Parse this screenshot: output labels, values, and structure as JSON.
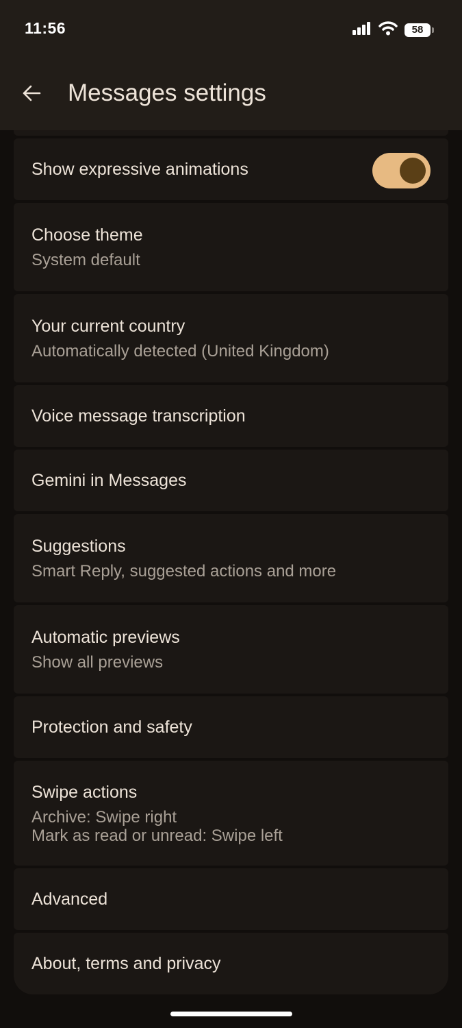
{
  "status_bar": {
    "time": "11:56",
    "battery": "58",
    "icons": [
      "signal-icon",
      "wifi-icon",
      "battery-icon"
    ]
  },
  "app_bar": {
    "title": "Messages settings",
    "back_icon": "arrow-back-icon"
  },
  "settings": {
    "items": [
      {
        "title": "Show expressive animations",
        "toggle_on": true
      },
      {
        "title": "Choose theme",
        "subtitle": "System default"
      },
      {
        "title": "Your current country",
        "subtitle": "Automatically detected (United Kingdom)"
      },
      {
        "title": "Voice message transcription"
      },
      {
        "title": "Gemini in Messages"
      },
      {
        "title": "Suggestions",
        "subtitle": "Smart Reply, suggested actions and more"
      },
      {
        "title": "Automatic previews",
        "subtitle": "Show all previews"
      },
      {
        "title": "Protection and safety"
      },
      {
        "title": "Swipe actions",
        "subtitle": "Archive: Swipe right",
        "subtitle2": "Mark as read or unread: Swipe left"
      },
      {
        "title": "Advanced"
      },
      {
        "title": "About, terms and privacy"
      }
    ]
  },
  "colors": {
    "background": "#110e0c",
    "header": "#221d18",
    "card": "#1b1714",
    "accent": "#e7ba82",
    "text_primary": "#ede3d8",
    "text_secondary": "#a9a096"
  }
}
